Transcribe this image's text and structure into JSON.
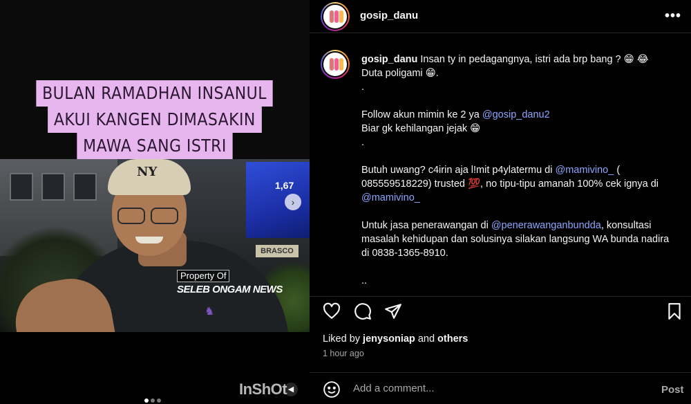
{
  "media": {
    "caption_lines": [
      "BULAN RAMADHAN INSANUL",
      "AKUI KANGEN DIMASAKIN",
      "MAWA SANG ISTRI"
    ],
    "cap_logo": "NY",
    "billboard_text": "1,67",
    "shop_sign": "BRASCO",
    "watermark_line1": "Property Of",
    "watermark_line2": "SELEB ONGAM NEWS",
    "app_watermark": "InShOt",
    "carousel": {
      "count": 3,
      "active": 1
    }
  },
  "post": {
    "username": "gosip_danu",
    "more_icon": "more-horizontal-icon"
  },
  "caption": {
    "username": "gosip_danu",
    "p1": "Insan ty in pedagangnya, istri ada brp bang ? 😁 😂",
    "p1b": "Duta poligami 😁.",
    "dot1": ".",
    "p2a": "Follow akun mimin ke 2 ya ",
    "p2_link": "@gosip_danu2",
    "p2b": "Biar gk kehilangan jejak 😁",
    "dot2": ".",
    "p3a": "Butuh uwang? c4irin aja l!mit p4ylatermu di ",
    "p3_link1": "@mamivino_",
    "p3b": " ( 085559518229) trusted 💯, no tipu-tipu amanah 100% cek ignya di ",
    "p3_link2": "@mamivino_",
    "p4a": "Untuk jasa penerawangan di ",
    "p4_link": "@penerawanganbundda",
    "p4b": ", konsultasi masalah kehidupan dan solusinya silakan langsung WA bunda nadira di 0838-1365-8910.",
    "dots_end": ".."
  },
  "actions": {
    "like_icon": "heart-icon",
    "comment_icon": "comment-icon",
    "share_icon": "share-icon",
    "save_icon": "bookmark-icon"
  },
  "likes": {
    "prefix": "Liked by ",
    "user": "jenysoniap",
    "middle": " and ",
    "others": "others"
  },
  "timestamp": "1 hour ago",
  "add_comment": {
    "placeholder": "Add a comment...",
    "post_label": "Post"
  },
  "colors": {
    "caption_bg": "#e8b6ee",
    "link": "#8fa6ff",
    "muted": "#a8a8a8"
  }
}
